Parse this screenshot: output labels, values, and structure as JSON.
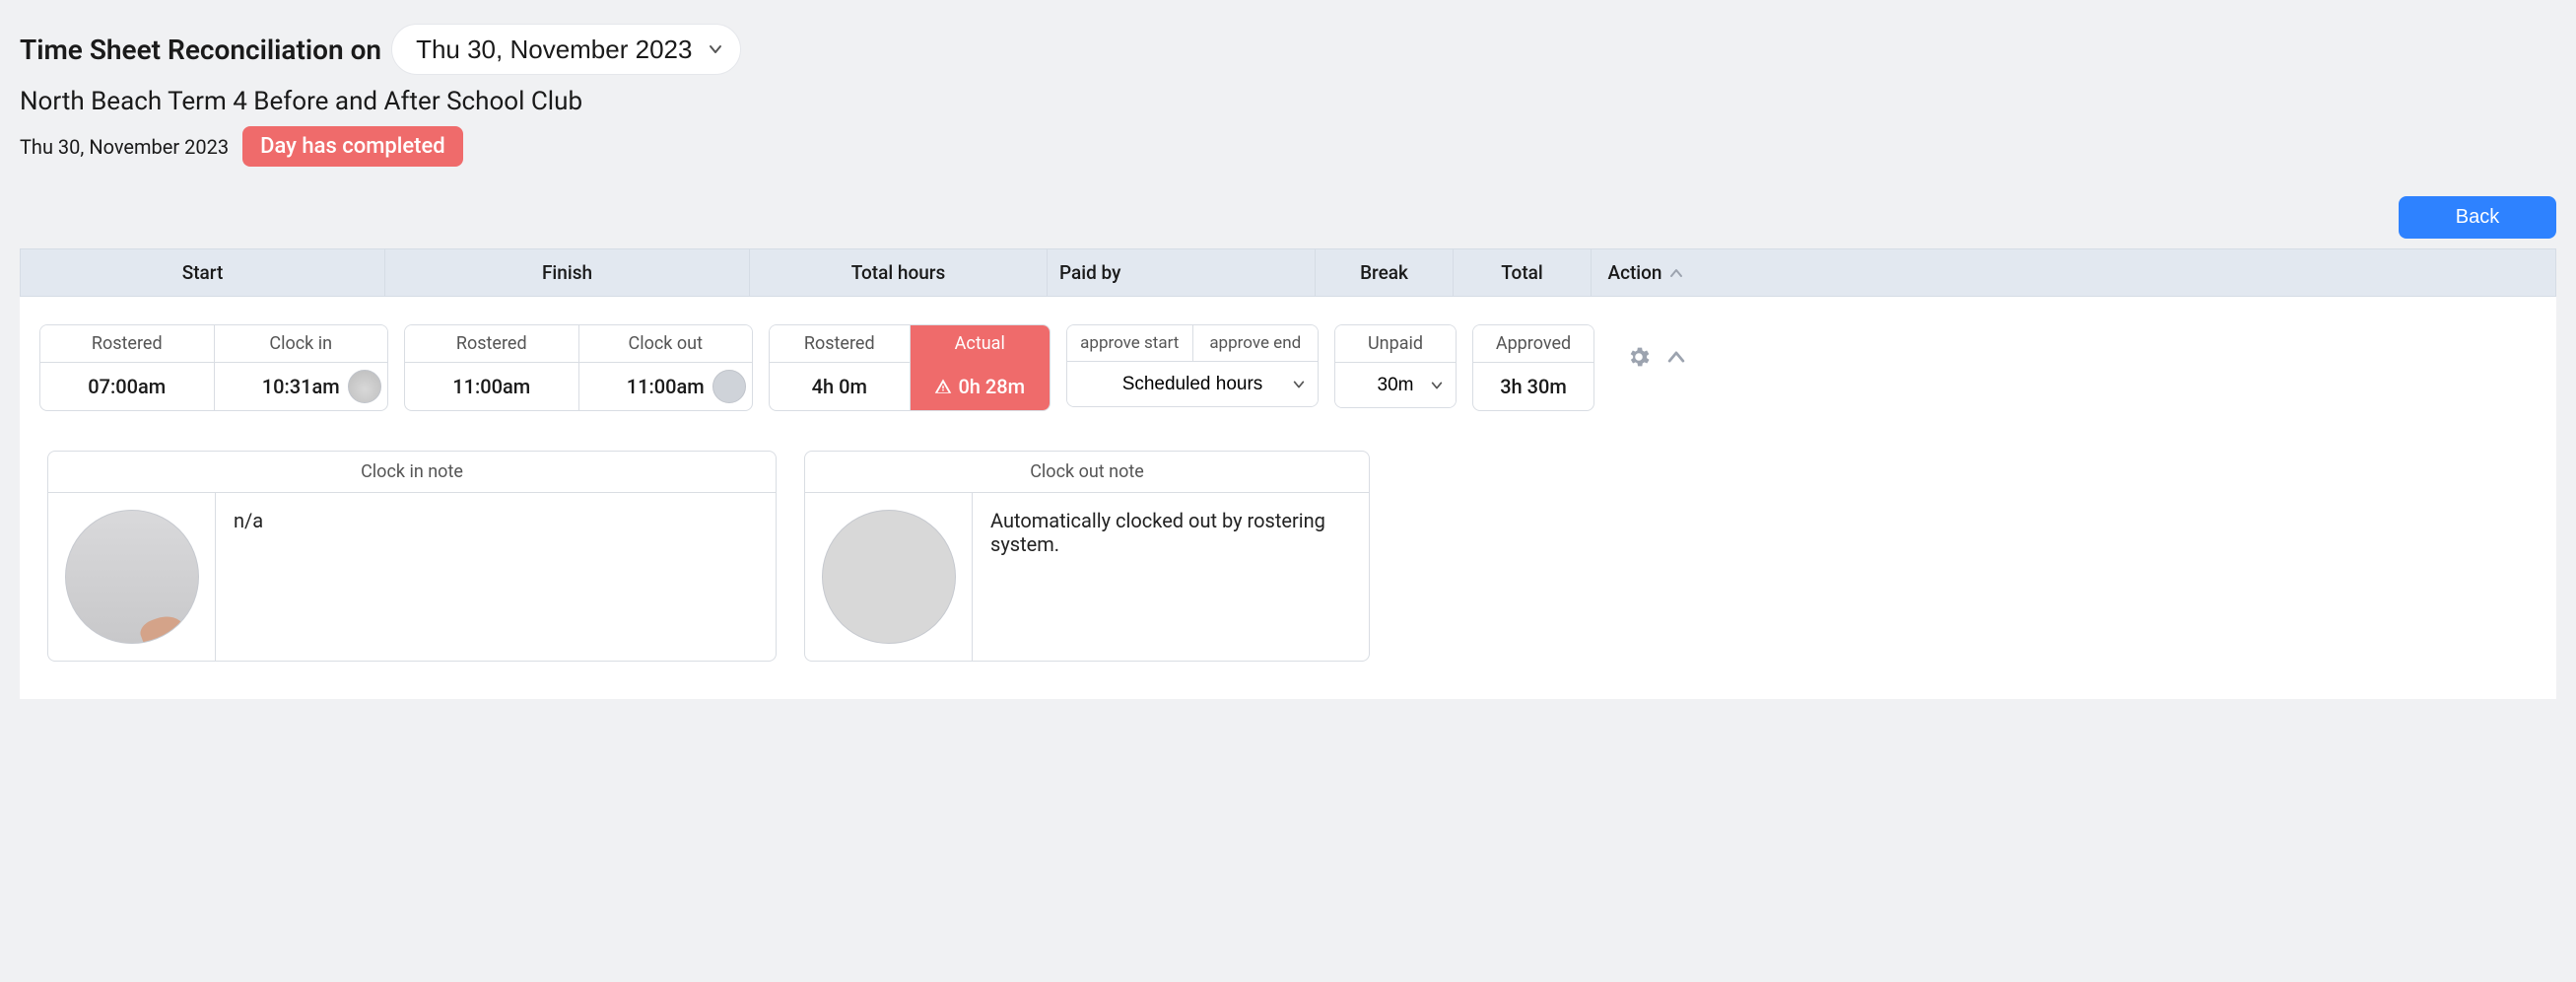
{
  "header": {
    "title": "Time Sheet Reconciliation on",
    "selected_date": "Thu 30, November 2023"
  },
  "subtitle": "North Beach Term 4 Before and After School Club",
  "meta": {
    "date": "Thu 30, November 2023",
    "status": "Day has completed"
  },
  "buttons": {
    "back": "Back"
  },
  "columns": {
    "start": "Start",
    "finish": "Finish",
    "total_hours": "Total hours",
    "paid_by": "Paid by",
    "break": "Break",
    "total": "Total",
    "action": "Action"
  },
  "labels": {
    "rostered": "Rostered",
    "clock_in": "Clock in",
    "clock_out": "Clock out",
    "actual": "Actual",
    "approve_start": "approve start",
    "approve_end": "approve end",
    "unpaid": "Unpaid",
    "approved": "Approved",
    "clock_in_note": "Clock in note",
    "clock_out_note": "Clock out note"
  },
  "row": {
    "start_rostered": "07:00am",
    "start_clockin": "10:31am",
    "finish_rostered": "11:00am",
    "finish_clockout": "11:00am",
    "total_rostered": "4h 0m",
    "total_actual": "0h 28m",
    "paid_by_selected": "Scheduled hours",
    "break_value": "30m",
    "total_approved": "3h 30m"
  },
  "notes": {
    "clock_in": "n/a",
    "clock_out": "Automatically clocked out by rostering system."
  }
}
